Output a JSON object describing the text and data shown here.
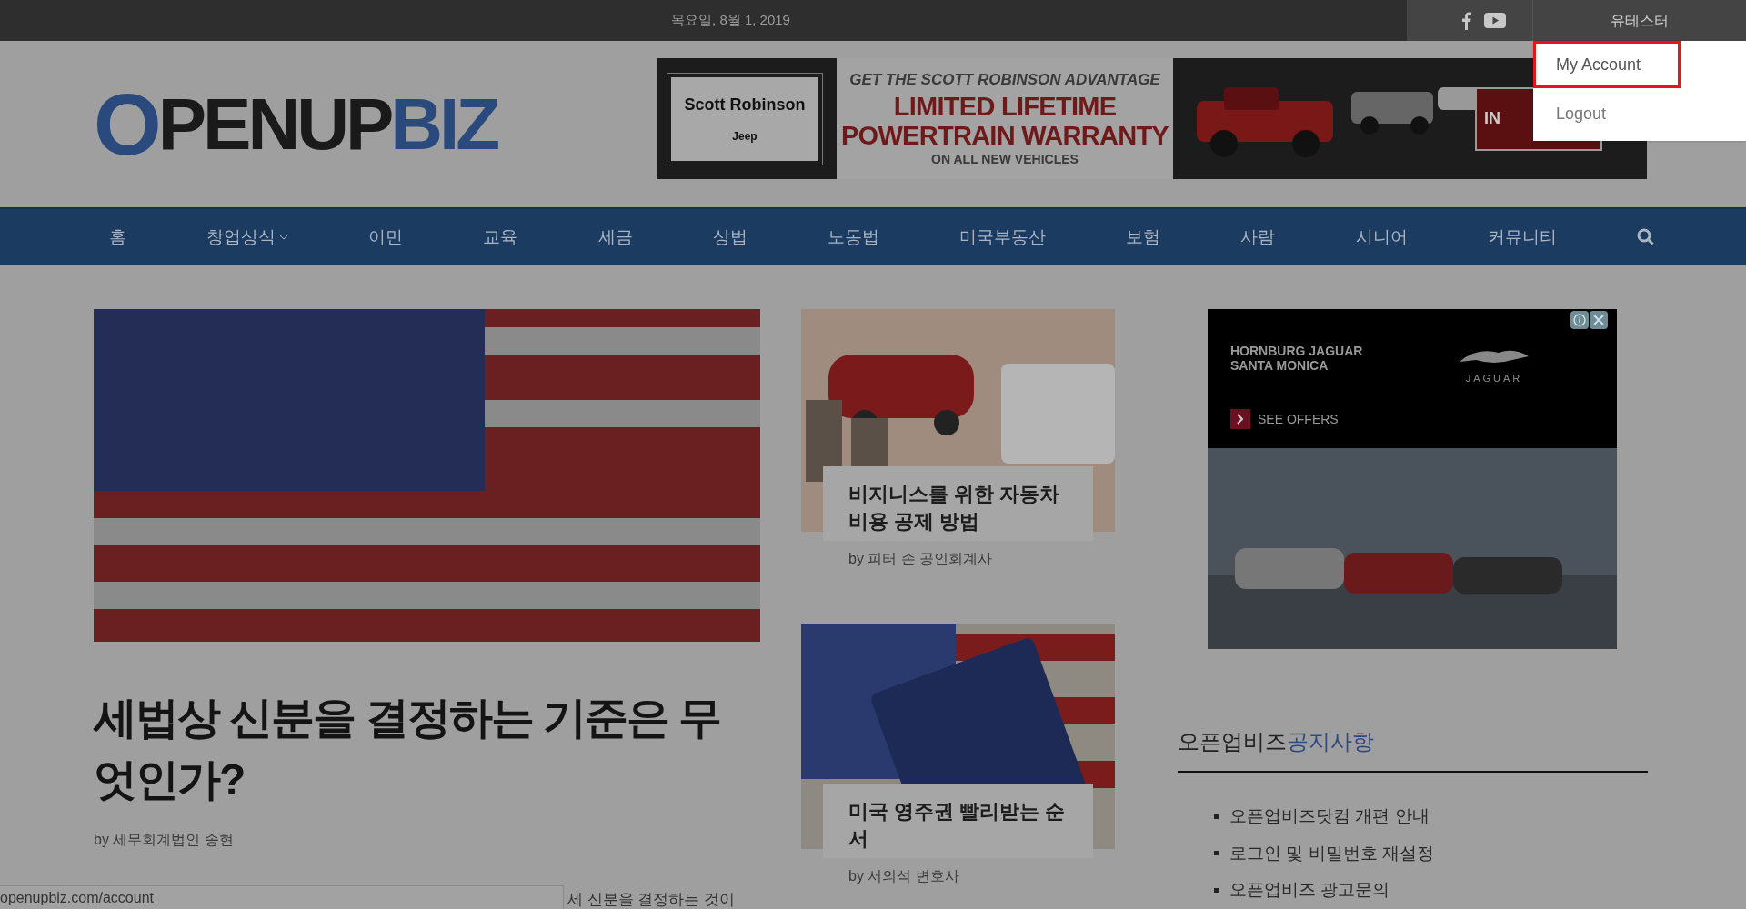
{
  "top_bar": {
    "date": "목요일, 8월 1, 2019",
    "account_label": "유테스터"
  },
  "account_menu": {
    "items": [
      {
        "label": "My Account",
        "selected": true
      },
      {
        "label": "Logout",
        "selected": false
      }
    ]
  },
  "logo": {
    "initial": "O",
    "middle": "PENUP",
    "accent": "BIZ"
  },
  "banner_ad": {
    "dealer": "Scott Robinson",
    "brand": "Jeep",
    "tagline": "GET THE SCOTT ROBINSON ADVANTAGE",
    "headline_1": "LIMITED LIFETIME",
    "headline_2": "POWERTRAIN WARRANTY",
    "subline": "ON ALL NEW VEHICLES",
    "button": "IN"
  },
  "nav": {
    "items": [
      {
        "label": "홈",
        "kind": "link"
      },
      {
        "label": "창업상식",
        "kind": "dropdown"
      },
      {
        "label": "이민",
        "kind": "link"
      },
      {
        "label": "교육",
        "kind": "link"
      },
      {
        "label": "세금",
        "kind": "link"
      },
      {
        "label": "상법",
        "kind": "link"
      },
      {
        "label": "노동법",
        "kind": "link"
      },
      {
        "label": "미국부동산",
        "kind": "link"
      },
      {
        "label": "보험",
        "kind": "link"
      },
      {
        "label": "사람",
        "kind": "link"
      },
      {
        "label": "시니어",
        "kind": "link"
      },
      {
        "label": "커뮤니티",
        "kind": "link"
      }
    ]
  },
  "hero": {
    "title": "세법상 신분을 결정하는 기준은 무엇인가?",
    "byline_prefix": "by",
    "author": "세무회계법인 송현",
    "excerpt": "세 신분을 결정하는 것이"
  },
  "cards": [
    {
      "kind": "car",
      "title": "비지니스를 위한 자동차 비용 공제 방법",
      "byline_prefix": "by",
      "author": "피터 손 공인회계사"
    },
    {
      "kind": "passport",
      "title": "미국 영주권 빨리받는 순서",
      "byline_prefix": "by",
      "author": "서의석 변호사"
    }
  ],
  "sidebar_ad": {
    "dealer_1": "HORNBURG JAGUAR",
    "dealer_2": "SANTA MONICA",
    "brand": "JAGUAR",
    "cta": "SEE OFFERS"
  },
  "notices": {
    "heading_1": "오픈업비즈",
    "heading_2": "공지사항",
    "items": [
      "오픈업비즈닷컴 개편 안내",
      "로그인 및 비밀번호 재설정",
      "오픈업비즈 광고문의"
    ]
  },
  "status_bar": {
    "url": "openupbiz.com/account"
  }
}
